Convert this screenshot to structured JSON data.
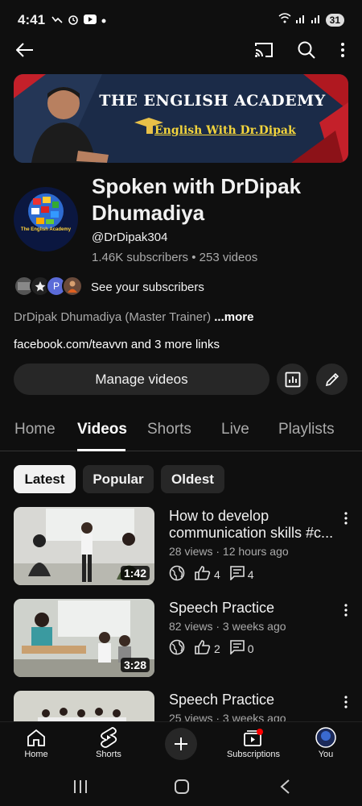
{
  "status_bar": {
    "time": "4:41",
    "battery": "31"
  },
  "banner": {
    "title": "THE ENGLISH ACADEMY",
    "subtitle": "English With Dr.Dipak"
  },
  "channel": {
    "avatar_text": "The English Academy",
    "name_line1": "Spoken with DrDipak",
    "name_line2": "Dhumadiya",
    "handle": "@DrDipak304",
    "stats": "1.46K subscribers • 253 videos",
    "subscriber_avatar_initial": "P",
    "see_subscribers": "See your subscribers",
    "description": "DrDipak Dhumadiya (Master Trainer)",
    "more_label": " ...more",
    "links": "facebook.com/teavvn and 3 more links",
    "manage_label": "Manage videos"
  },
  "tabs": [
    "Home",
    "Videos",
    "Shorts",
    "Live",
    "Playlists"
  ],
  "active_tab": "Videos",
  "chips": [
    "Latest",
    "Popular",
    "Oldest"
  ],
  "videos": [
    {
      "title_line1": "How to develop",
      "title_line2": "communication skills #c...",
      "meta": "28 views · 12 hours ago",
      "likes": "4",
      "comments": "4",
      "duration": "1:42"
    },
    {
      "title_line1": "Speech Practice",
      "meta": "82 views · 3 weeks ago",
      "likes": "2",
      "comments": "0",
      "duration": "3:28"
    },
    {
      "title_line1": "Speech Practice",
      "meta": "25 views · 3 weeks ago"
    }
  ],
  "bottom_nav": {
    "home": "Home",
    "shorts": "Shorts",
    "subscriptions": "Subscriptions",
    "you": "You"
  },
  "colors": {
    "background": "#0f0f0f",
    "surface": "#272727",
    "accent_red": "#ff0000",
    "banner_gold": "#f2d43c"
  }
}
